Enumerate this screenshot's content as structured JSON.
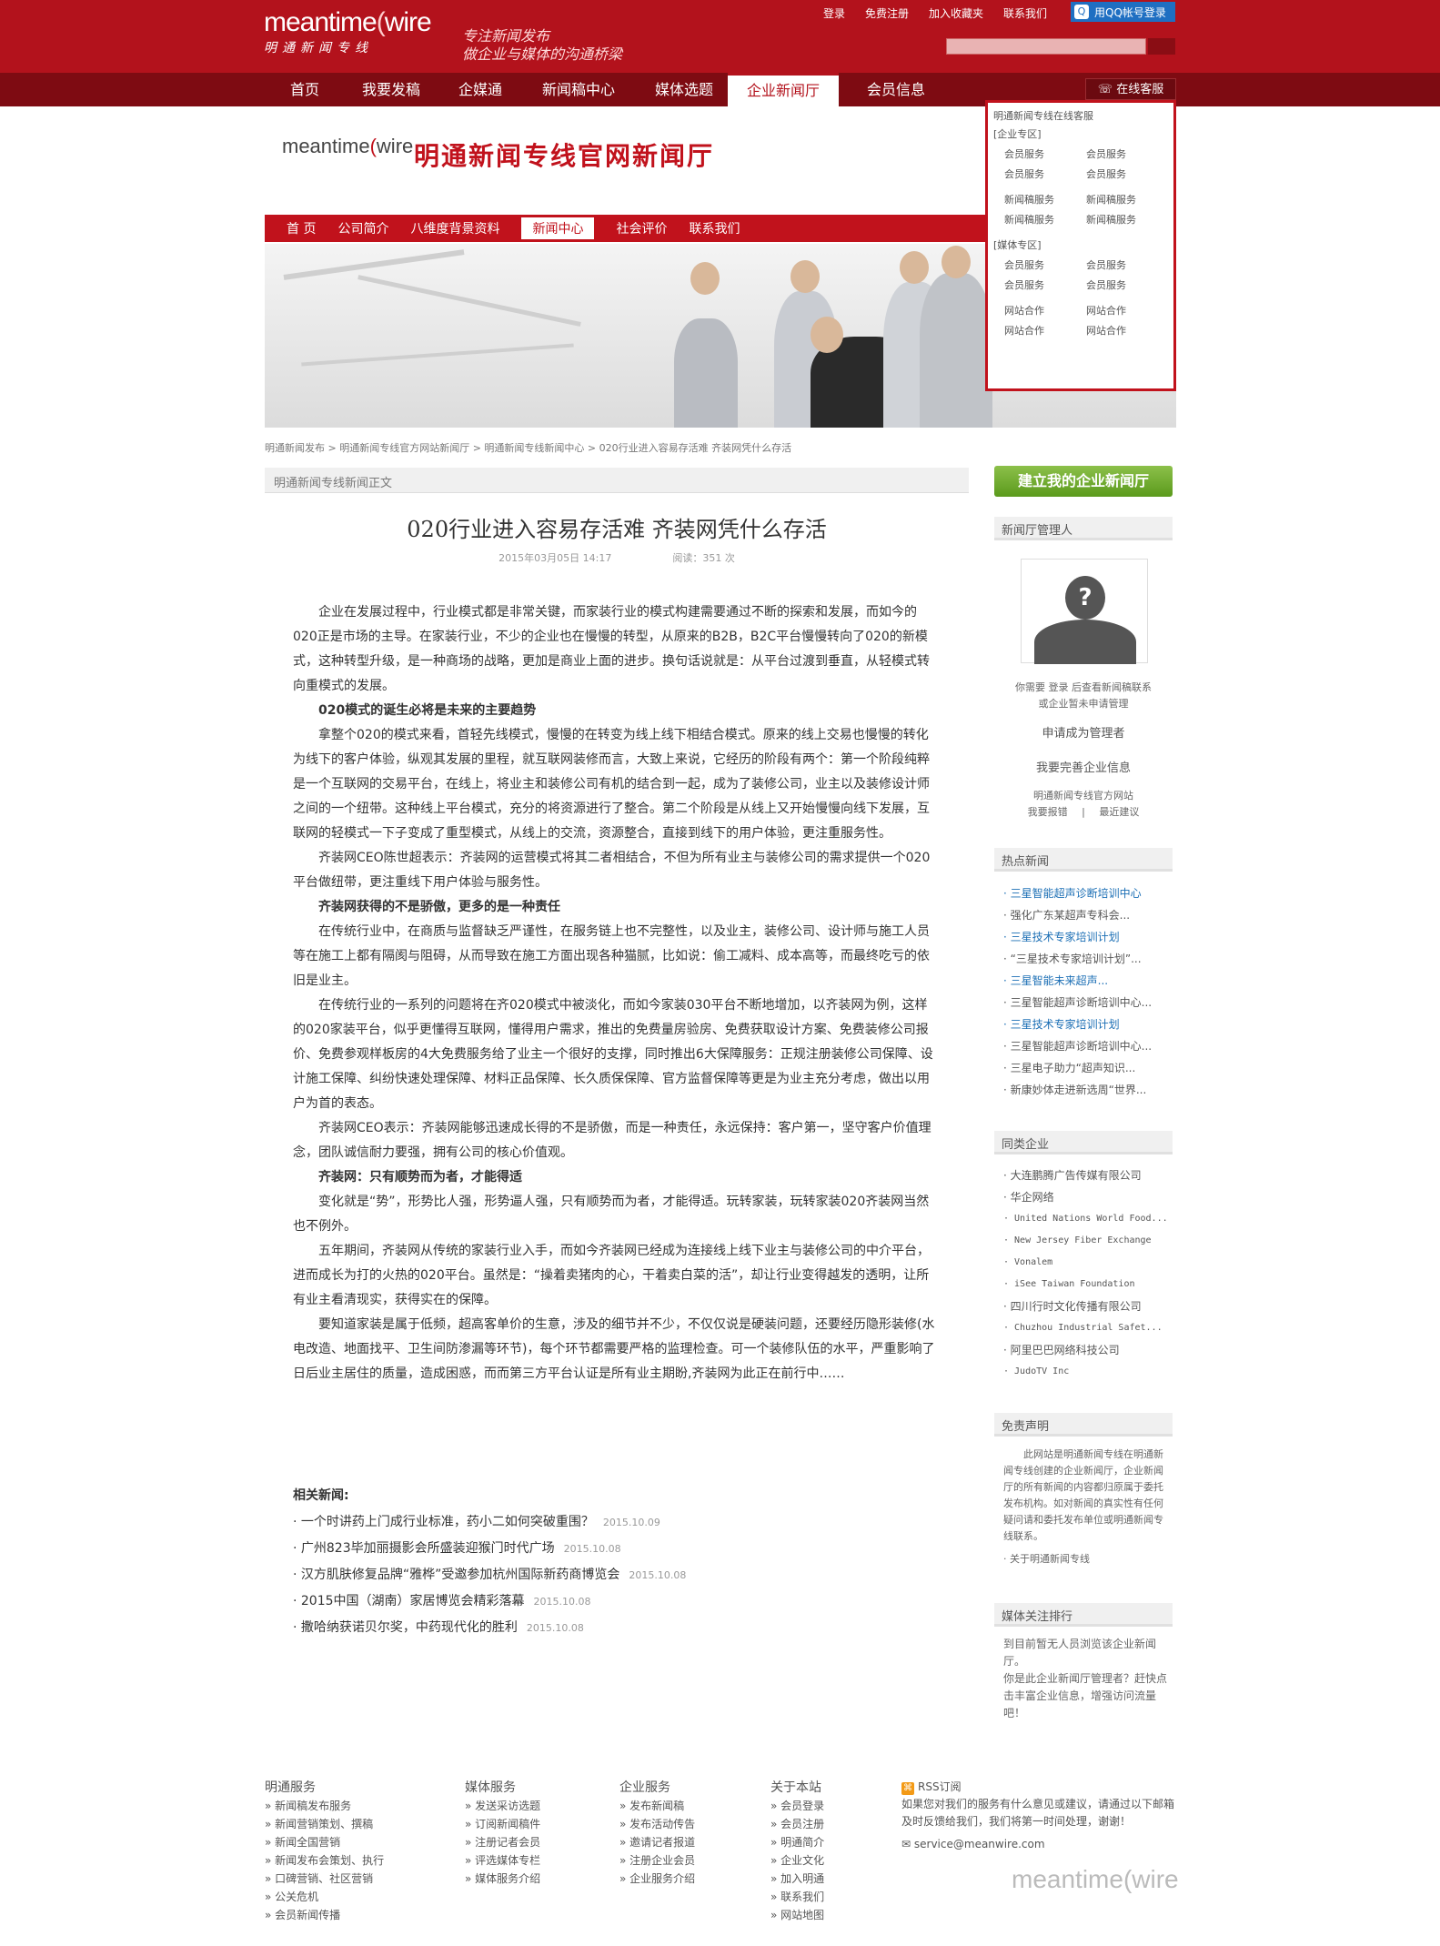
{
  "header": {
    "logo_word": "meantime",
    "logo_word2": "wire",
    "logo_sub": "明通新闻专线",
    "slogan_line1": "专注新闻发布",
    "slogan_line2": "做企业与媒体的沟通桥梁",
    "links": [
      "登录",
      "免费注册",
      "加入收藏夹",
      "联系我们"
    ],
    "qq_label": "用QQ帐号登录"
  },
  "main_nav": {
    "items": [
      "首页",
      "我要发稿",
      "企媒通",
      "新闻稿中心",
      "媒体选题",
      "企业新闻厅",
      "会员信息"
    ],
    "active": "企业新闻厅",
    "service": "在线客服"
  },
  "dropdown": {
    "intro": "明通新闻专线在线客服",
    "ent_head": "[企业专区]",
    "ent_grid1": [
      "会员服务",
      "会员服务",
      "会员服务",
      "会员服务"
    ],
    "ent_grid2": [
      "新闻稿服务",
      "新闻稿服务",
      "新闻稿服务",
      "新闻稿服务"
    ],
    "media_head": "[媒体专区]",
    "media_grid1": [
      "会员服务",
      "会员服务",
      "会员服务",
      "会员服务"
    ],
    "media_grid2": [
      "网站合作",
      "网站合作",
      "网站合作",
      "网站合作"
    ]
  },
  "newsroom": {
    "logo_word": "meantime",
    "logo_word2": "wire",
    "title": "明通新闻专线官网新闻厅",
    "subnav": [
      "首 页",
      "公司简介",
      "八维度背景资料",
      "新闻中心",
      "社会评价",
      "联系我们"
    ],
    "subnav_active": "新闻中心"
  },
  "breadcrumb": "明通新闻发布 > 明通新闻专线官方网站新闻厅 > 明通新闻专线新闻中心 > 020行业进入容易存活难 齐装网凭什么存活",
  "section_title": "明通新闻专线新闻正文",
  "article": {
    "title": "020行业进入容易存活难  齐装网凭什么存活",
    "date": "2015年03月05日 14:17",
    "views": "阅读：351 次",
    "paragraphs": [
      {
        "bold": false,
        "text": "企业在发展过程中，行业模式都是非常关键，而家装行业的模式构建需要通过不断的探索和发展，而如今的020正是市场的主导。在家装行业，不少的企业也在慢慢的转型，从原来的B2B，B2C平台慢慢转向了020的新模式，这种转型升级，是一种商场的战略，更加是商业上面的进步。换句话说就是：从平台过渡到垂直，从轻模式转向重模式的发展。"
      },
      {
        "bold": true,
        "text": "020模式的诞生必将是未来的主要趋势"
      },
      {
        "bold": false,
        "text": "拿整个020的模式来看，首轻先线模式，慢慢的在转变为线上线下相结合模式。原来的线上交易也慢慢的转化为线下的客户体验，纵观其发展的里程，就互联网装修而言，大致上来说，它经历的阶段有两个：第一个阶段纯粹是一个互联网的交易平台，在线上，将业主和装修公司有机的结合到一起，成为了装修公司，业主以及装修设计师之间的一个纽带。这种线上平台模式，充分的将资源进行了整合。第二个阶段是从线上又开始慢慢向线下发展，互联网的轻模式一下子变成了重型模式，从线上的交流，资源整合，直接到线下的用户体验，更注重服务性。"
      },
      {
        "bold": false,
        "text": "齐装网CEO陈世超表示：齐装网的运营模式将其二者相结合，不但为所有业主与装修公司的需求提供一个020平台做纽带，更注重线下用户体验与服务性。"
      },
      {
        "bold": true,
        "text": "齐装网获得的不是骄傲，更多的是一种责任"
      },
      {
        "bold": false,
        "text": "在传统行业中，在商质与监督缺乏严谨性，在服务链上也不完整性，以及业主，装修公司、设计师与施工人员等在施工上都有隔阂与阻碍，从而导致在施工方面出现各种猫腻，比如说：偷工减料、成本高等，而最终吃亏的依旧是业主。"
      },
      {
        "bold": false,
        "text": "在传统行业的一系列的问题将在齐020模式中被淡化，而如今家装030平台不断地增加，以齐装网为例，这样的020家装平台，似乎更懂得互联网，懂得用户需求，推出的免费量房验房、免费获取设计方案、免费装修公司报价、免费参观样板房的4大免费服务给了业主一个很好的支撑，同时推出6大保障服务：正规注册装修公司保障、设计施工保障、纠纷快速处理保障、材料正品保障、长久质保保障、官方监督保障等更是为业主充分考虑，做出以用户为首的表态。"
      },
      {
        "bold": false,
        "text": "齐装网CEO表示：齐装网能够迅速成长得的不是骄傲，而是一种责任，永远保持：客户第一，坚守客户价值理念，团队诚信耐力要强，拥有公司的核心价值观。"
      },
      {
        "bold": true,
        "text": "齐装网：只有顺势而为者，才能得适"
      },
      {
        "bold": false,
        "text": "变化就是“势”，形势比人强，形势逼人强，只有顺势而为者，才能得适。玩转家装，玩转家装020齐装网当然也不例外。"
      },
      {
        "bold": false,
        "text": "五年期间，齐装网从传统的家装行业入手，而如今齐装网已经成为连接线上线下业主与装修公司的中介平台，进而成长为打的火热的020平台。虽然是：“操着卖猪肉的心，干着卖白菜的活”，却让行业变得越发的透明，让所有业主看清现实，获得实在的保障。"
      },
      {
        "bold": false,
        "text": "要知道家装是属于低频，超高客单价的生意，涉及的细节并不少，不仅仅说是硬装问题，还要经历隐形装修(水电改造、地面找平、卫生间防渗漏等环节)，每个环节都需要严格的监理检查。可一个装修队伍的水平，严重影响了日后业主居住的质量，造成困惑，而而第三方平台认证是所有业主期盼,齐装网为此正在前行中……"
      }
    ]
  },
  "related": {
    "title": "相关新闻:",
    "items": [
      {
        "text": "一个时讲药上门成行业标准，药小二如何突破重围？",
        "date": "2015.10.09"
      },
      {
        "text": "广州823毕加丽摄影会所盛装迎猴门时代广场",
        "date": "2015.10.08"
      },
      {
        "text": "汉方肌肤修复品牌“雅桦”受邀参加杭州国际新药商博览会",
        "date": "2015.10.08"
      },
      {
        "text": "2015中国（湖南）家居博览会精彩落幕",
        "date": "2015.10.08"
      },
      {
        "text": "撒哈纳获诺贝尔奖，中药现代化的胜利",
        "date": "2015.10.08"
      }
    ]
  },
  "sidebar": {
    "create_btn": "建立我的企业新闻厅",
    "manager_head": "新闻厅管理人",
    "manager_text1": "你需要 登录 后查看新闻稿联系",
    "manager_text2": "或企业暂未申请管理",
    "apply_link": "申请成为管理者",
    "improve_link": "我要完善企业信息",
    "site_line": "明通新闻专线官方网站",
    "login_link": "我要报错",
    "sep": "|",
    "correct_link": "最近建议",
    "hot_head": "热点新闻",
    "hot": [
      "三星智能超声诊断培训中心",
      "强化广东某超声专科会...",
      "三星技术专家培训计划",
      "“三星技术专家培训计划”...",
      "三星智能未来超声...",
      "三星智能超声诊断培训中心...",
      "三星技术专家培训计划",
      "三星智能超声诊断培训中心...",
      "三星电子助力“超声知识...",
      "新康妙体走进新选周“世界..."
    ],
    "peer_head": "同类企业",
    "peers": [
      "大连鹏腾广告传媒有限公司",
      "华企网络",
      "United Nations World Food...",
      "New Jersey Fiber Exchange",
      "Vonalem",
      "iSee Taiwan Foundation",
      "四川行时文化传播有限公司",
      "Chuzhou Industrial Safet...",
      "阿里巴巴网络科技公司",
      "JudoTV Inc"
    ],
    "disclaimer_head": "免责声明",
    "disclaimer": "此网站是明通新闻专线在明通新闻专线创建的企业新闻厅，企业新闻厅的所有新闻的内容都归原属于委托发布机构。如对新闻的真实性有任何疑问请和委托发布单位或明通新闻专线联系。",
    "about_link": "关于明通新闻专线",
    "media_head": "媒体关注排行",
    "media_text1": "到目前暂无人员浏览该企业新闻厅。",
    "media_text2": "你是此企业新闻厅管理者？赶快点击丰富企业信息，增强访问流量吧！"
  },
  "footer": {
    "cols": [
      {
        "title": "明通服务",
        "items": [
          "新闻稿发布服务",
          "新闻营销策划、撰稿",
          "新闻全国营销",
          "新闻发布会策划、执行",
          "口碑营销、社区营销",
          "公关危机",
          "会员新闻传播"
        ]
      },
      {
        "title": "媒体服务",
        "items": [
          "发送采访选题",
          "订阅新闻稿件",
          "注册记者会员",
          "评选媒体专栏",
          "媒体服务介绍"
        ]
      },
      {
        "title": "企业服务",
        "items": [
          "发布新闻稿",
          "发布活动传告",
          "邀请记者报道",
          "注册企业会员",
          "企业服务介绍"
        ]
      },
      {
        "title": "关于本站",
        "items": [
          "会员登录",
          "会员注册",
          "明通简介",
          "企业文化",
          "加入明通",
          "联系我们",
          "网站地图"
        ]
      }
    ],
    "rss_label": "RSS订阅",
    "contact_text": "如果您对我们的服务有什么意见或建议，请通过以下邮箱及时反馈给我们，我们将第一时间处理，谢谢！",
    "email": "service@meanwire.com",
    "logo_word": "meantime",
    "logo_word2": "wire"
  }
}
